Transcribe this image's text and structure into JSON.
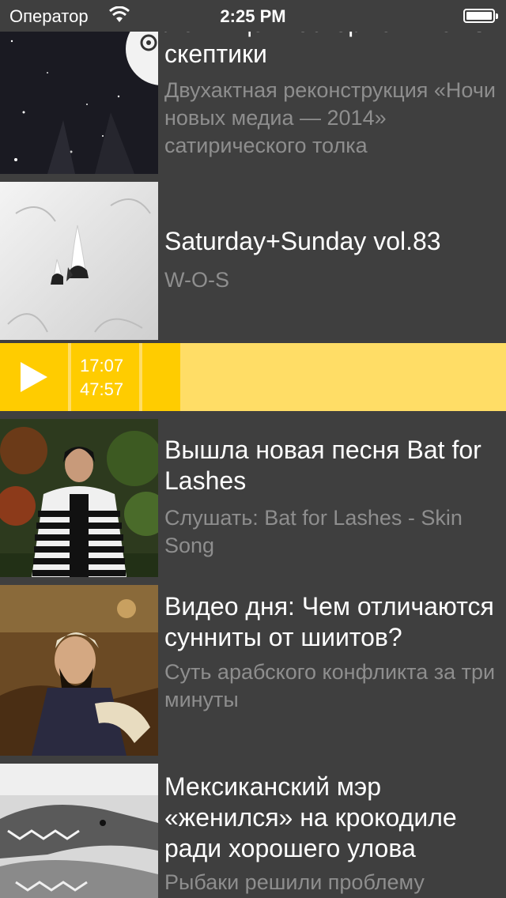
{
  "status_bar": {
    "carrier": "Оператор",
    "time": "2:25 PM"
  },
  "feed": {
    "items": [
      {
        "title": "Ленивце: Восторженные vs. скептики",
        "subtitle": "Двухактная реконструкция «Ночи новых медиа — 2014» сатирического толка"
      },
      {
        "title": "Saturday+Sunday vol.83",
        "subtitle": "W-O-S"
      },
      {
        "title": "Вышла новая песня Bat for Lashes",
        "subtitle": "Слушать: Bat for Lashes - Skin Song"
      },
      {
        "title": "Видео дня: Чем отличаются сунниты от шиитов?",
        "subtitle": "Суть арабского конфликта за три минуты"
      },
      {
        "title": "Мексиканский мэр «женился» на крокодиле ради хорошего улова",
        "subtitle": "Рыбаки решили проблему"
      }
    ]
  },
  "player": {
    "elapsed": "17:07",
    "duration": "47:57",
    "progress_fraction": 0.357,
    "accent_color": "#ffcc00",
    "track_color": "#ffdd66",
    "play_icon": "play-icon"
  },
  "colors": {
    "background": "#3f3f3f",
    "title": "#ffffff",
    "subtitle": "#8e8e8e"
  }
}
